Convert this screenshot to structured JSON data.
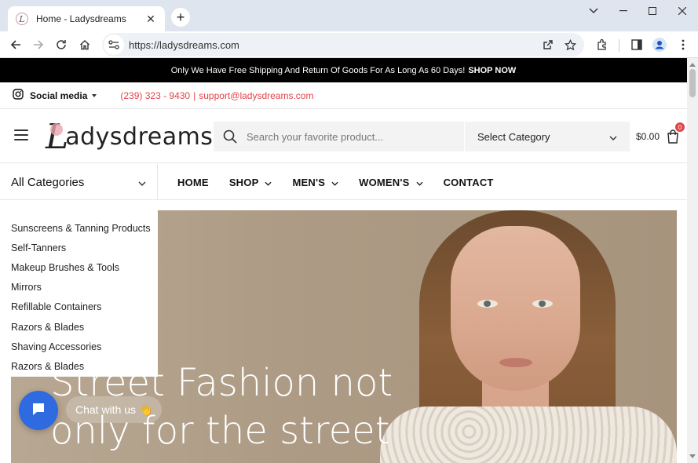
{
  "browser": {
    "tab_title": "Home - Ladysdreams",
    "favicon_letter": "L",
    "url": "https://ladysdreams.com",
    "icons": [
      "back-icon",
      "forward-icon",
      "reload-icon",
      "home-icon",
      "site-info-icon",
      "share-icon",
      "bookmark-star-icon",
      "extensions-icon",
      "side-panel-icon",
      "profile-icon",
      "menu-dots-icon"
    ]
  },
  "announcement": {
    "text": "Only We Have Free Shipping And Return Of Goods For As Long As 60 Days!",
    "cta": "SHOP NOW"
  },
  "topbar": {
    "social_label": "Social media",
    "phone": "(239) 323 - 9430",
    "separator": "|",
    "email": "support@ladysdreams.com"
  },
  "header": {
    "logo_initial": "L",
    "logo_text": "adysdreams",
    "search_placeholder": "Search your favorite product...",
    "category_select": "Select Category",
    "cart_total": "$0.00",
    "cart_count": "0"
  },
  "nav": {
    "all_categories": "All Categories",
    "items": [
      {
        "label": "HOME",
        "dropdown": false
      },
      {
        "label": "SHOP",
        "dropdown": true
      },
      {
        "label": "MEN'S",
        "dropdown": true
      },
      {
        "label": "WOMEN'S",
        "dropdown": true
      },
      {
        "label": "CONTACT",
        "dropdown": false
      }
    ]
  },
  "categories": [
    "Sunscreens & Tanning Products",
    "Self-Tanners",
    "Makeup Brushes & Tools",
    "Mirrors",
    "Refillable Containers",
    "Razors & Blades",
    "Shaving Accessories",
    "Razors & Blades"
  ],
  "hero": {
    "line1": "Street Fashion not",
    "line2": "only for the street"
  },
  "chat": {
    "label": "Chat with us",
    "emoji": "👋"
  },
  "colors": {
    "accent_red": "#e0454b",
    "chat_blue": "#2f6ae0",
    "announce_bg": "#000000"
  }
}
